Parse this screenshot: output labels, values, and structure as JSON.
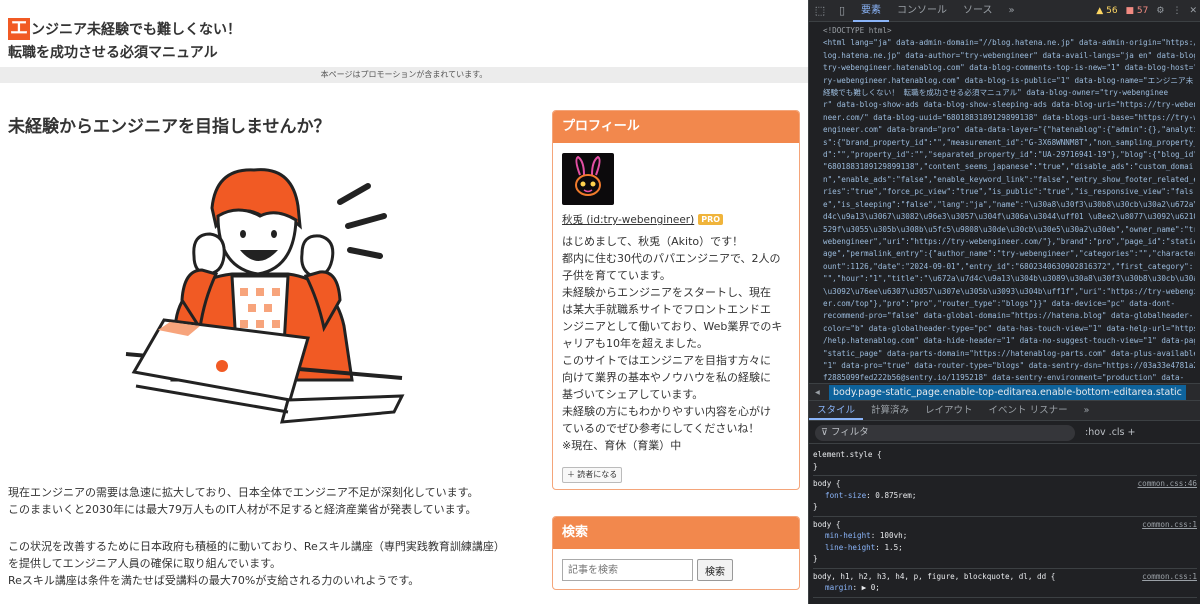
{
  "page": {
    "logo_letter": "エ",
    "title_line1": "ンジニア未経験でも難しくない！",
    "title_line2": "転職を成功させる必須マニュアル",
    "promo_notice": "本ページはプロモーションが含まれています。",
    "main_heading": "未経験からエンジニアを目指しませんか？",
    "paragraph1": [
      "現在エンジニアの需要は急速に拡大しており、日本全体でエンジニア不足が深刻化しています。",
      "このままいくと2030年には最大79万人ものIT人材が不足すると経済産業省が発表しています。"
    ],
    "paragraph2": [
      "この状況を改善するために日本政府も積極的に動いており、Reスキル講座（専門実践教育訓練講座）",
      "を提供してエンジニア人員の確保に取り組んでいます。",
      "Reスキル講座は条件を満たせば受講料の最大70%が支給される力のいれようです。"
    ]
  },
  "profile": {
    "heading": "プロフィール",
    "name": "秋兎 (id:try-webengineer)",
    "badge": "PRO",
    "description": [
      "はじめまして、秋兎（Akito）です！",
      "都内に住む30代のパパエンジニアで、2人の",
      "子供を育てています。",
      "未経験からエンジニアをスタートし、現在",
      "は某大手就職系サイトでフロントエンドエ",
      "ンジニアとして働いており、Web業界でのキ",
      "ャリアも10年を超えました。",
      "このサイトではエンジニアを目指す方々に",
      "向けて業界の基本やノウハウを私の経験に",
      "基づいてシェアしています。",
      "未経験の方にもわかりやすい内容を心がけ",
      "ているのでぜひ参考にしてくださいね！",
      "※現在、育休（育業）中"
    ],
    "reader_button": "＋ 読者になる"
  },
  "search": {
    "heading": "検索",
    "placeholder": "記事を検索",
    "button": "検索"
  },
  "devtools": {
    "tabs": [
      "要素",
      "コンソール",
      "ソース"
    ],
    "active_tab": "要素",
    "more": "»",
    "warnings": "56",
    "errors": "57",
    "breadcrumb": "body.page-static_page.enable-top-editarea.enable-bottom-editarea.static",
    "sub_tabs": [
      "スタイル",
      "計算済み",
      "レイアウト",
      "イベント リスナー"
    ],
    "filter_placeholder": "フィルタ",
    "filter_tools": ":hov  .cls  +",
    "html_lines": [
      "<!DOCTYPE html>",
      "<html lang=\"ja\" data-admin-domain=\"//blog.hatena.ne.jp\" data-admin-origin=\"https://b",
      "log.hatena.ne.jp\" data-author=\"try-webengineer\" data-avail-langs=\"ja en\" data-blog=\"",
      "try-webengineer.hatenablog.com\" data-blog-comments-top-is-new=\"1\" data-blog-host=\"t",
      "ry-webengineer.hatenablog.com\" data-blog-is-public=\"1\" data-blog-name=\"エンジニア未",
      "経験でも難しくない！ 転職を成功させる必須マニュアル\" data-blog-owner=\"try-webenginee",
      "r\" data-blog-show-ads data-blog-show-sleeping-ads data-blog-uri=\"https://try-webengi",
      "neer.com/\" data-blog-uuid=\"6801883189129899138\" data-blogs-uri-base=\"https://try-web",
      "engineer.com\" data-brand=\"pro\" data-data-layer=\"{\"hatenablog\":{\"admin\":{},\"analytic",
      "s\":{\"brand_property_id\":\"\",\"measurement_id\":\"G-3X68WNNM8T\",\"non_sampling_property_i",
      "d\":\"\",\"property_id\":\"\",\"separated_property_id\":\"UA-29716941-19\"},\"blog\":{\"blog_id\":",
      "\"6801883189129899138\",\"content_seems_japanese\":\"true\",\"disable_ads\":\"custom_domai",
      "n\",\"enable_ads\":\"false\",\"enable_keyword_link\":\"false\",\"entry_show_footer_related_ent",
      "ries\":\"true\",\"force_pc_view\":\"true\",\"is_public\":\"true\",\"is_responsive_view\":\"fals",
      "e\",\"is_sleeping\":\"false\",\"lang\":\"ja\",\"name\":\"\\u30a8\\u30f3\\u30b8\\u30cb\\u30a2\\u672a\\u7",
      "d4c\\u9a13\\u3067\\u3082\\u96e3\\u3057\\u304f\\u306a\\u3044\\uff01 \\u8ee2\\u8077\\u3092\\u6210\\u",
      "529f\\u3055\\u305b\\u308b\\u5fc5\\u9808\\u30de\\u30cb\\u30e5\\u30a2\\u30eb\",\"owner_name\":\"try-",
      "webengineer\",\"uri\":\"https://try-webengineer.com/\"},\"brand\":\"pro\",\"page_id\":\"static_p",
      "age\",\"permalink_entry\":{\"author_name\":\"try-webengineer\",\"categories\":\"\",\"character_c",
      "ount\":1126,\"date\":\"2024-09-01\",\"entry_id\":\"6802340630902816372\",\"first_category\":",
      "\"\",\"hour\":\"1\",\"title\":\"\\u672a\\u7d4c\\u9a13\\u304b\\u3089\\u30a8\\u30f3\\u30b8\\u30cb\\u30a2",
      "\\u3092\\u76ee\\u6307\\u3057\\u307e\\u305b\\u3093\\u304b\\uff1f\",\"uri\":\"https://try-webengine",
      "er.com/top\"},\"pro\":\"pro\",\"router_type\":\"blogs\"}}\" data-device=\"pc\" data-dont-",
      "recommend-pro=\"false\" data-global-domain=\"https://hatena.blog\" data-globalheader-",
      "color=\"b\" data-globalheader-type=\"pc\" data-has-touch-view=\"1\" data-help-url=\"https:/",
      "/help.hatenablog.com\" data-hide-header=\"1\" data-no-suggest-touch-view=\"1\" data-page=",
      "\"static_page\" data-parts-domain=\"https://hatenablog-parts.com\" data-plus-available=",
      "\"1\" data-pro=\"true\" data-router-type=\"blogs\" data-sentry-dsn=\"https://03a33e4781a24c",
      "f2885099fed222b56@sentry.io/1195218\" data-sentry-environment=\"production\" data-"
    ],
    "rules": [
      {
        "selector": "element.style {",
        "source": "",
        "props": [],
        "close": "}"
      },
      {
        "selector": "body {",
        "source": "common.css:46",
        "props": [
          [
            "font-size",
            "0.875rem"
          ]
        ],
        "close": "}"
      },
      {
        "selector": "body {",
        "source": "common.css:1",
        "props": [
          [
            "min-height",
            "100vh"
          ],
          [
            "line-height",
            "1.5"
          ]
        ],
        "close": "}"
      },
      {
        "selector": "body, h1, h2, h3, h4, p, figure, blockquote, dl, dd {",
        "source": "common.css:1",
        "props": [
          [
            "margin",
            "▶ 0"
          ]
        ],
        "close": ""
      }
    ]
  }
}
